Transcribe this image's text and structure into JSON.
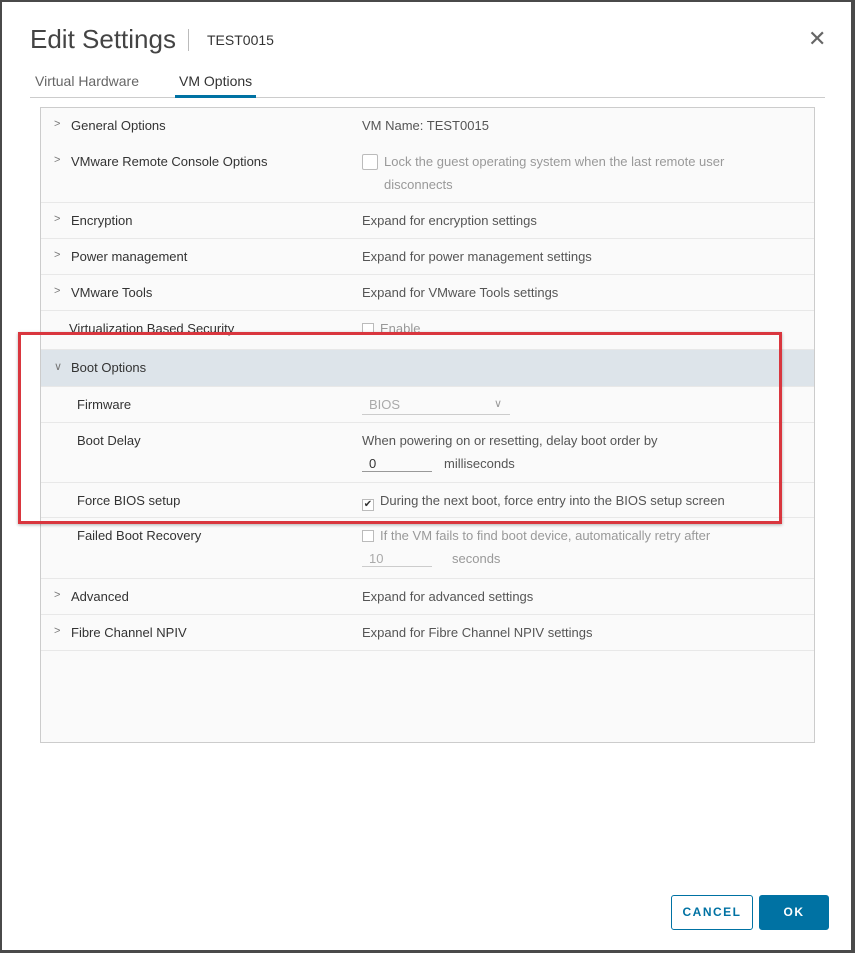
{
  "dialog": {
    "title": "Edit Settings",
    "vm_name": "TEST0015",
    "close_icon": "close-icon"
  },
  "tabs": [
    {
      "label": "Virtual Hardware",
      "active": false
    },
    {
      "label": "VM Options",
      "active": true
    }
  ],
  "rows": {
    "general": {
      "label": "General Options",
      "value": "VM Name: TEST0015"
    },
    "vmrc": {
      "label": "VMware Remote Console Options",
      "value": "Lock the guest operating system when the last remote user disconnects",
      "checked": false
    },
    "encryption": {
      "label": "Encryption",
      "value": "Expand for encryption settings"
    },
    "power": {
      "label": "Power management",
      "value": "Expand for power management settings"
    },
    "tools": {
      "label": "VMware Tools",
      "value": "Expand for VMware Tools settings"
    },
    "vbs": {
      "label": "Virtualization Based Security",
      "value": "Enable",
      "checked": false
    },
    "boot": {
      "label": "Boot Options",
      "firmware": {
        "label": "Firmware",
        "value": "BIOS"
      },
      "delay": {
        "label": "Boot Delay",
        "text": "When powering on or resetting, delay boot order by",
        "value": "0",
        "unit": "milliseconds"
      },
      "force_bios": {
        "label": "Force BIOS setup",
        "value": "During the next boot, force entry into the BIOS setup screen",
        "checked": true
      },
      "failed_recovery": {
        "label": "Failed Boot Recovery",
        "value": "If the VM fails to find boot device, automatically retry after",
        "seconds": "10",
        "unit": "seconds",
        "checked": false
      }
    },
    "advanced": {
      "label": "Advanced",
      "value": "Expand for advanced settings"
    },
    "fibre": {
      "label": "Fibre Channel NPIV",
      "value": "Expand for Fibre Channel NPIV settings"
    }
  },
  "buttons": {
    "cancel": "CANCEL",
    "ok": "OK"
  },
  "colors": {
    "accent": "#0072a3",
    "highlight": "#d9363e",
    "boot_header_bg": "#dde4ea"
  }
}
